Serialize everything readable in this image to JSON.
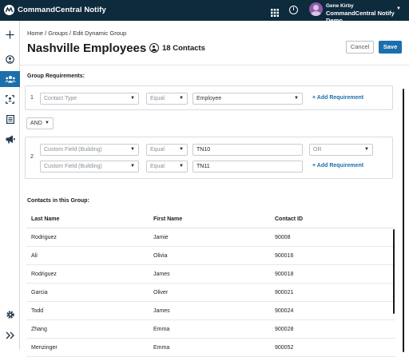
{
  "header": {
    "app_name": "CommandCentral Notify",
    "user_name": "Gene Kirby",
    "user_org": "CommandCentral Notify Demo"
  },
  "sidebar": {
    "items": [
      {
        "icon": "plus-icon"
      },
      {
        "icon": "person-circle-icon"
      },
      {
        "icon": "groups-icon",
        "active": true
      },
      {
        "icon": "contact-card-icon"
      },
      {
        "icon": "list-icon"
      },
      {
        "icon": "megaphone-icon"
      },
      {
        "icon": "gear-icon"
      },
      {
        "icon": "expand-chevrons-icon"
      }
    ]
  },
  "page": {
    "breadcrumb": "Home / Groups / Edit Dynamic Group",
    "title": "Nashville Employees",
    "contacts_count": "18 Contacts",
    "cancel_label": "Cancel",
    "save_label": "Save"
  },
  "requirements": {
    "label": "Group Requirements:",
    "req1": {
      "number": "1",
      "field": "Contact Type",
      "operator": "Equal",
      "value": "Employee",
      "add_label": "+ Add Requirement"
    },
    "joiner": "AND",
    "req2": {
      "number": "2",
      "row1": {
        "field": "Custom Field (Building)",
        "operator": "Equal",
        "value": "TN10",
        "combinator": "OR"
      },
      "row2": {
        "field": "Custom Field (Building)",
        "operator": "Equal",
        "value": "TN11"
      },
      "add_label": "+ Add Requirement"
    }
  },
  "contacts": {
    "label": "Contacts in this Group:",
    "columns": {
      "last": "Last Name",
      "first": "First Name",
      "id": "Contact ID"
    },
    "rows": [
      {
        "last": "Rodriguez",
        "first": "Jamie",
        "id": "90008"
      },
      {
        "last": "Ali",
        "first": "Olivia",
        "id": "900016"
      },
      {
        "last": "Rodriguez",
        "first": "James",
        "id": "900018"
      },
      {
        "last": "Garcia",
        "first": "Oliver",
        "id": "900021"
      },
      {
        "last": "Todd",
        "first": "James",
        "id": "900024"
      },
      {
        "last": "Zhang",
        "first": "Emma",
        "id": "900028"
      },
      {
        "last": "Menzinger",
        "first": "Emma",
        "id": "900052"
      }
    ]
  },
  "colors": {
    "header_bg": "#0e2a3d",
    "accent": "#1c6fab"
  }
}
